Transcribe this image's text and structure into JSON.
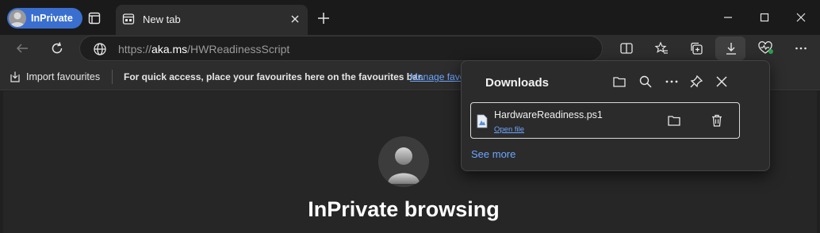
{
  "titlebar": {
    "profile_label": "InPrivate",
    "tab_title": "New tab"
  },
  "toolbar": {
    "url_prefix": "https://",
    "url_domain": "aka.ms",
    "url_path": "/HWReadinessScript"
  },
  "favourites_bar": {
    "import_label": "Import favourites",
    "hint": "For quick access, place your favourites here on the favourites bar.",
    "manage_link": "Manage favourites now"
  },
  "page": {
    "heading": "InPrivate browsing"
  },
  "downloads": {
    "title": "Downloads",
    "items": [
      {
        "filename": "HardwareReadiness.ps1",
        "action_label": "Open file"
      }
    ],
    "see_more": "See more"
  },
  "colors": {
    "accent": "#3a6fd0",
    "link": "#6ea6ff"
  }
}
